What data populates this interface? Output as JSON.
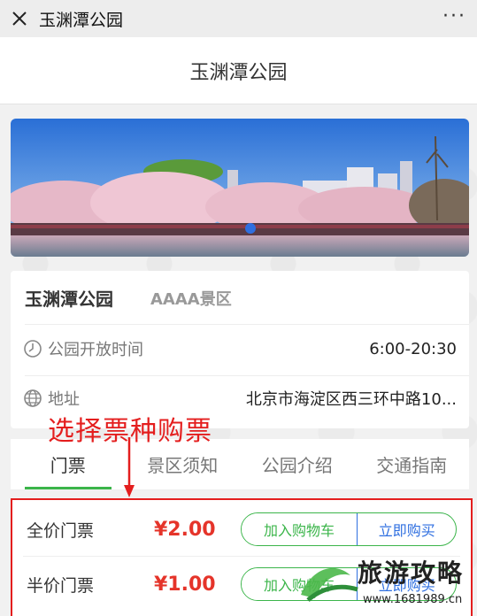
{
  "topbar": {
    "title": "玉渊潭公园",
    "more": "···"
  },
  "page": {
    "title": "玉渊潭公园"
  },
  "park": {
    "name": "玉渊潭公园",
    "level": "AAAA景区",
    "hours_label": "公园开放时间",
    "hours_value": "6:00-20:30",
    "address_label": "地址",
    "address_value": "北京市海淀区西三环中路10..."
  },
  "annotation": {
    "text": "选择票种购票"
  },
  "tabs": [
    {
      "label": "门票"
    },
    {
      "label": "景区须知"
    },
    {
      "label": "公园介绍"
    },
    {
      "label": "交通指南"
    }
  ],
  "tickets": [
    {
      "name": "全价门票",
      "price": "¥2.00",
      "cart_label": "加入购物车",
      "buy_label": "立即购买"
    },
    {
      "name": "半价门票",
      "price": "¥1.00",
      "cart_label": "加入购物车",
      "buy_label": "立即购买"
    }
  ],
  "watermark": {
    "text": "旅游攻略",
    "url": "www.1681989.cn"
  },
  "colors": {
    "accent_green": "#3bb54a",
    "accent_blue": "#2f6fe0",
    "price_red": "#e5342a",
    "annotation_red": "#e41e1e"
  }
}
